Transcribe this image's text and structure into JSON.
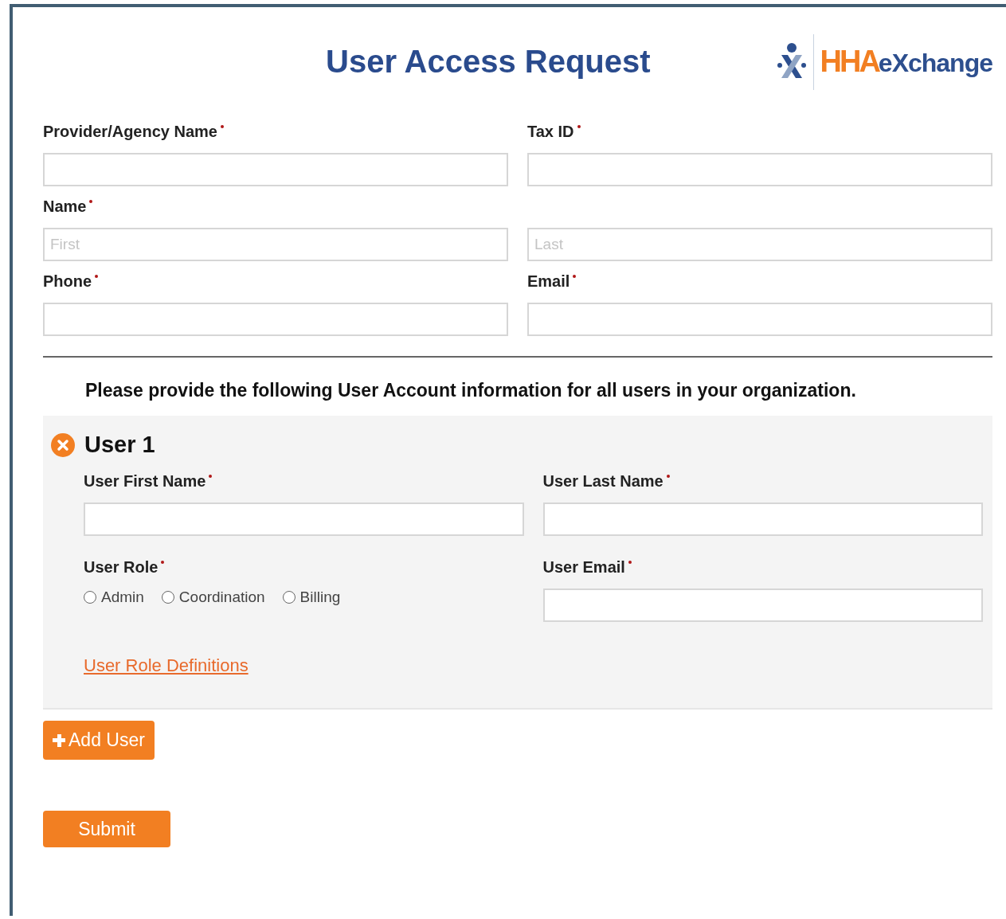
{
  "header": {
    "title": "User Access Request",
    "logo": {
      "primary": "HHA",
      "secondary": "eXchange"
    }
  },
  "rows": [
    [
      {
        "label": "Provider/Agency Name",
        "required": true
      },
      {
        "label": "Tax ID",
        "required": true
      }
    ],
    [
      {
        "label": "Name",
        "required": true,
        "placeholder": "First"
      },
      {
        "placeholder": "Last"
      }
    ],
    [
      {
        "label": "Phone",
        "required": true
      },
      {
        "label": "Email",
        "required": true
      }
    ]
  ],
  "instructions": "Please provide the following User Account information for all users in your organization.",
  "users": [
    {
      "title": "User 1",
      "first_name": {
        "label": "User First Name",
        "required": true
      },
      "last_name": {
        "label": "User Last Name",
        "required": true
      },
      "role": {
        "label": "User Role",
        "required": true,
        "options": [
          {
            "label": "Admin",
            "selected": false
          },
          {
            "label": "Coordination",
            "selected": false
          },
          {
            "label": "Billing",
            "selected": false
          }
        ]
      },
      "email": {
        "label": "User Email",
        "required": true
      },
      "link": "User Role Definitions"
    }
  ],
  "add_button": "Add User",
  "submit_button": "Submit"
}
